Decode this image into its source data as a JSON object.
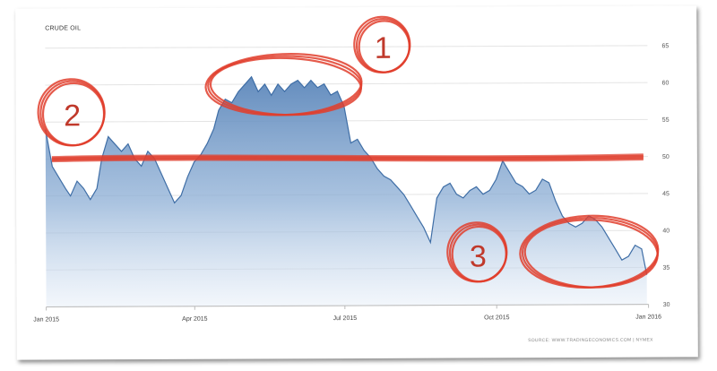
{
  "chart_data": {
    "type": "area",
    "title": "CRUDE OIL",
    "source": "SOURCE: WWW.TRADINGECONOMICS.COM | NYMEX",
    "x_ticks": [
      "Jan 2015",
      "Apr 2015",
      "Jul 2015",
      "Oct 2015",
      "Jan 2016"
    ],
    "y_ticks": [
      30,
      35,
      40,
      45,
      50,
      55,
      60,
      65
    ],
    "ylim": [
      30,
      66
    ],
    "xlim": [
      "2015-01-01",
      "2016-01-01"
    ],
    "grid": true,
    "series": [
      {
        "x": [
          "2015-01-01",
          "2015-01-05",
          "2015-01-09",
          "2015-01-13",
          "2015-01-16",
          "2015-01-20",
          "2015-01-24",
          "2015-01-28",
          "2015-02-01",
          "2015-02-04",
          "2015-02-08",
          "2015-02-12",
          "2015-02-16",
          "2015-02-20",
          "2015-02-24",
          "2015-02-28",
          "2015-03-04",
          "2015-03-08",
          "2015-03-12",
          "2015-03-16",
          "2015-03-20",
          "2015-03-24",
          "2015-03-28",
          "2015-04-01",
          "2015-04-05",
          "2015-04-09",
          "2015-04-13",
          "2015-04-16",
          "2015-04-20",
          "2015-04-24",
          "2015-04-28",
          "2015-05-02",
          "2015-05-06",
          "2015-05-10",
          "2015-05-14",
          "2015-05-18",
          "2015-05-22",
          "2015-05-26",
          "2015-05-30",
          "2015-06-03",
          "2015-06-07",
          "2015-06-11",
          "2015-06-15",
          "2015-06-19",
          "2015-06-23",
          "2015-06-27",
          "2015-07-01",
          "2015-07-05",
          "2015-07-09",
          "2015-07-13",
          "2015-07-17",
          "2015-07-21",
          "2015-07-25",
          "2015-07-29",
          "2015-08-02",
          "2015-08-06",
          "2015-08-10",
          "2015-08-14",
          "2015-08-18",
          "2015-08-22",
          "2015-08-26",
          "2015-08-30",
          "2015-09-03",
          "2015-09-07",
          "2015-09-11",
          "2015-09-15",
          "2015-09-19",
          "2015-09-23",
          "2015-09-27",
          "2015-10-01",
          "2015-10-05",
          "2015-10-09",
          "2015-10-13",
          "2015-10-17",
          "2015-10-21",
          "2015-10-25",
          "2015-10-29",
          "2015-11-02",
          "2015-11-06",
          "2015-11-10",
          "2015-11-14",
          "2015-11-18",
          "2015-11-22",
          "2015-11-26",
          "2015-11-30",
          "2015-12-04",
          "2015-12-08",
          "2015-12-12",
          "2015-12-16",
          "2015-12-20",
          "2015-12-24",
          "2015-12-28",
          "2015-12-31"
        ],
        "y": [
          54,
          49,
          47.5,
          46,
          45,
          47,
          46,
          44.5,
          46,
          50,
          53,
          52,
          51,
          52,
          50,
          49,
          51,
          50,
          48,
          46,
          44,
          45,
          47.5,
          49.5,
          50.5,
          52,
          54,
          56.5,
          58,
          57.5,
          59,
          60,
          61,
          59,
          60,
          58.5,
          60,
          59,
          60,
          60.5,
          59.5,
          60.5,
          59.5,
          60,
          58.5,
          59,
          57,
          52,
          52.5,
          51,
          50,
          48.5,
          47.5,
          47,
          46,
          45,
          43.5,
          42,
          40.5,
          38.5,
          44.5,
          46,
          46.5,
          45,
          44.5,
          45.5,
          46,
          45,
          45.5,
          47,
          49.5,
          48,
          46.5,
          46,
          45,
          45.5,
          47,
          46.5,
          44,
          42,
          41,
          40.5,
          41,
          42,
          41.5,
          40.5,
          39,
          37.5,
          36,
          36.5,
          38,
          37.5,
          34
        ]
      }
    ],
    "annotations": [
      "1",
      "2",
      "3"
    ]
  }
}
